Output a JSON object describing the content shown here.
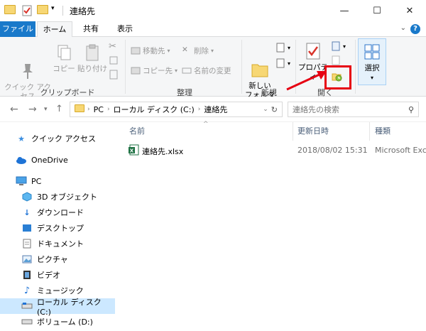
{
  "window": {
    "title": "連絡先",
    "minimize": "—",
    "maximize": "☐",
    "close": "✕"
  },
  "tabs": [
    {
      "label": "ファイル"
    },
    {
      "label": "ホーム"
    },
    {
      "label": "共有"
    },
    {
      "label": "表示"
    }
  ],
  "ribbon": {
    "clipboard": {
      "pin": "クイック アクセス\nにピン留め",
      "copy": "コピー",
      "paste": "貼り付け",
      "label": "クリップボード"
    },
    "organize": {
      "move_to": "移動先",
      "copy_to": "コピー先",
      "delete": "削除",
      "rename": "名前の変更",
      "label": "整理"
    },
    "new": {
      "new_folder": "新しい\nフォルダー",
      "label": "新規"
    },
    "open": {
      "properties": "プロパティ",
      "label": "開く"
    },
    "select": {
      "select": "選択"
    }
  },
  "address": {
    "parts": [
      "PC",
      "ローカル ディスク (C:)",
      "連絡先"
    ],
    "search_placeholder": "連絡先の検索"
  },
  "nav": {
    "items": [
      {
        "label": "クイック アクセス"
      },
      {
        "label": "OneDrive"
      },
      {
        "label": "PC"
      },
      {
        "label": "3D オブジェクト"
      },
      {
        "label": "ダウンロード"
      },
      {
        "label": "デスクトップ"
      },
      {
        "label": "ドキュメント"
      },
      {
        "label": "ピクチャ"
      },
      {
        "label": "ビデオ"
      },
      {
        "label": "ミュージック"
      },
      {
        "label": "ローカル ディスク (C:)"
      },
      {
        "label": "ボリューム (D:)"
      }
    ]
  },
  "columns": {
    "name": "名前",
    "modified": "更新日時",
    "type": "種類"
  },
  "files": [
    {
      "name": "連絡先.xlsx",
      "modified": "2018/08/02 15:31",
      "type": "Microsoft Exce"
    }
  ],
  "colors": {
    "accent": "#1979ca",
    "selection": "#cce8ff",
    "highlight": "#e60012"
  }
}
